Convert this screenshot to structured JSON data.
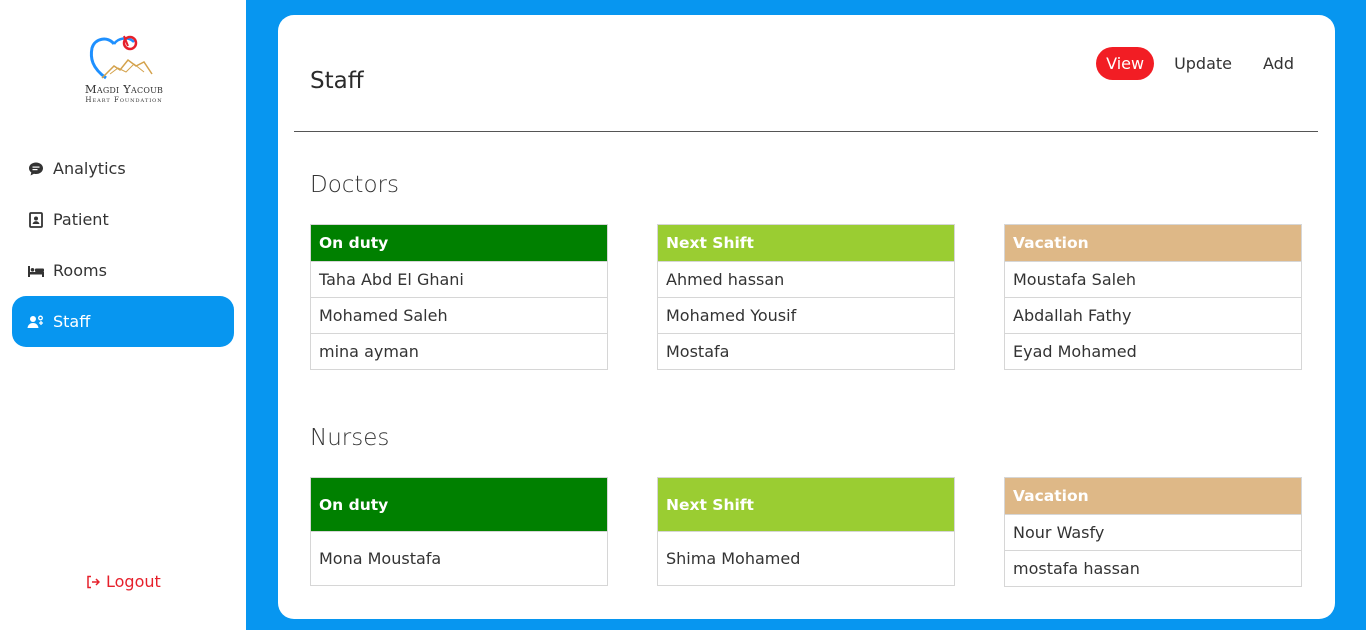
{
  "brand": {
    "name": "Magdi Yacoub",
    "subtitle": "Heart Foundation",
    "colors": {
      "heart_blue": "#1e90ff",
      "heart_red": "#e6202b",
      "mountain": "#d4a24c"
    }
  },
  "sidebar": {
    "items": [
      {
        "label": "Analytics",
        "icon": "chat-icon"
      },
      {
        "label": "Patient",
        "icon": "id-card-icon"
      },
      {
        "label": "Rooms",
        "icon": "bed-icon"
      },
      {
        "label": "Staff",
        "icon": "staff-icon",
        "active": true
      }
    ],
    "logout_label": "Logout"
  },
  "header": {
    "title": "Staff",
    "tabs": [
      {
        "label": "View",
        "active": true
      },
      {
        "label": "Update"
      },
      {
        "label": "Add"
      }
    ]
  },
  "doctors": {
    "title": "Doctors",
    "on_duty": {
      "header": "On duty",
      "rows": [
        "Taha Abd El Ghani",
        "Mohamed Saleh",
        "mina ayman"
      ]
    },
    "next_shift": {
      "header": "Next Shift",
      "rows": [
        "Ahmed hassan",
        "Mohamed Yousif",
        "Mostafa"
      ]
    },
    "vacation": {
      "header": "Vacation",
      "rows": [
        "Moustafa Saleh",
        "Abdallah Fathy",
        "Eyad Mohamed"
      ]
    }
  },
  "nurses": {
    "title": "Nurses",
    "on_duty": {
      "header": "On duty",
      "rows": [
        "Mona Moustafa"
      ]
    },
    "next_shift": {
      "header": "Next Shift",
      "rows": [
        "Shima Mohamed"
      ]
    },
    "vacation": {
      "header": "Vacation",
      "rows": [
        "Nour Wasfy",
        "mostafa hassan"
      ]
    }
  },
  "colors": {
    "accent": "#0796f0",
    "active_tab": "#f21d24",
    "on_duty": "#008000",
    "next_shift": "#9acd32",
    "vacation": "#deb887",
    "logout": "#e6202b"
  }
}
